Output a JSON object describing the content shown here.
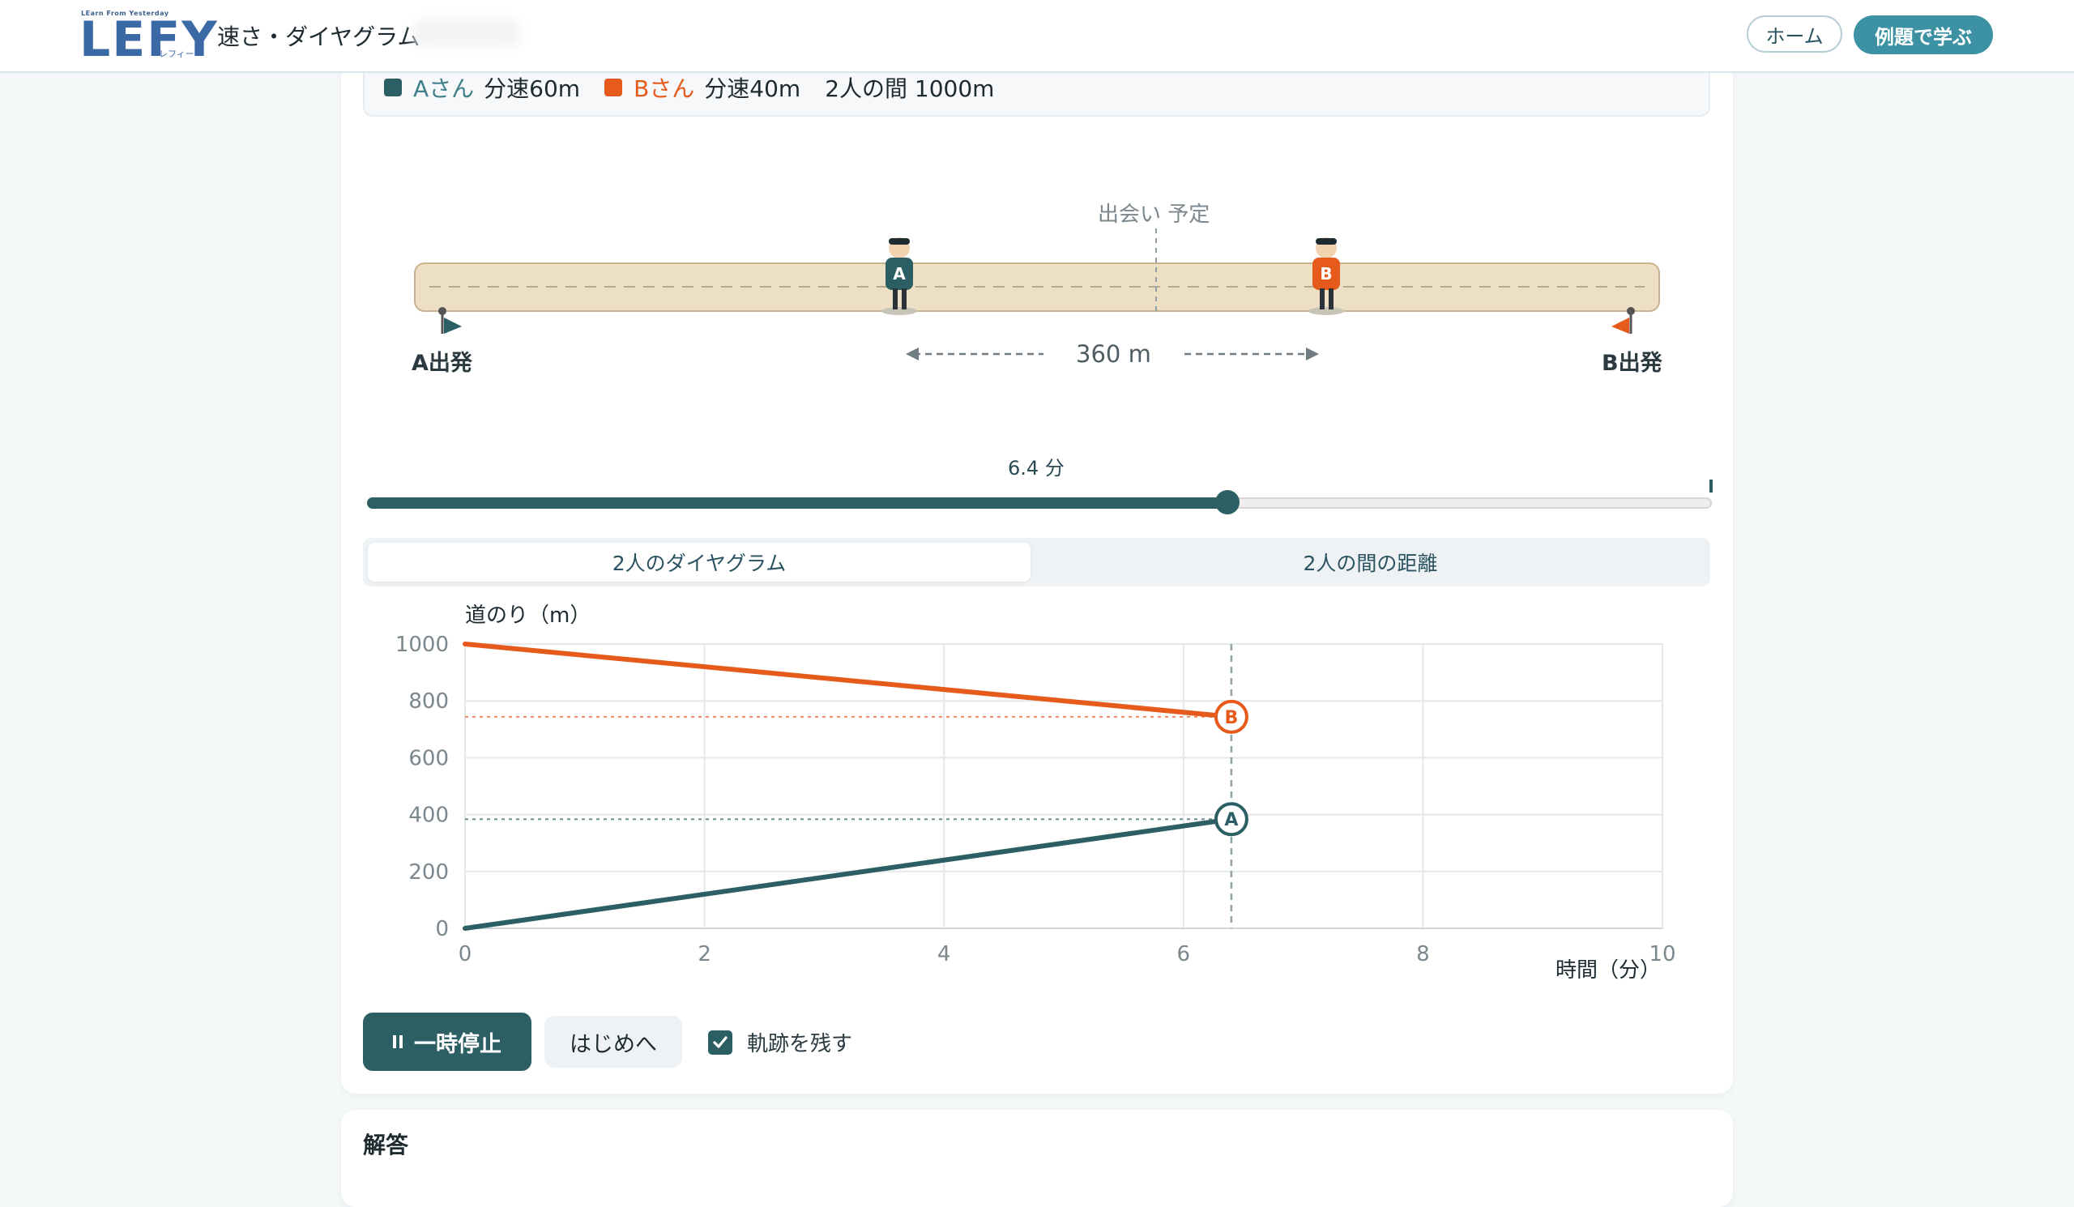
{
  "header": {
    "logo_tagline": "LEarn From Yesterday",
    "logo_word": "LEFY",
    "logo_kana": "レフィー",
    "title": "速さ・ダイヤグラム",
    "home_label": "ホーム",
    "learn_label": "例題で学ぶ"
  },
  "info": {
    "a_name": "Aさん",
    "a_speed": "分速60m",
    "b_name": "Bさん",
    "b_speed": "分速40m",
    "gap": "2人の間 1000m"
  },
  "track": {
    "meet_label": "出会い 予定",
    "start_a": "A出発",
    "start_b": "B出発",
    "distance_label": "360 m",
    "runner_a": "A",
    "runner_b": "B"
  },
  "slider": {
    "time_label": "6.4 分",
    "value_minutes": 6.4,
    "max_minutes": 10
  },
  "tabs": [
    {
      "label": "2人のダイヤグラム",
      "active": true
    },
    {
      "label": "2人の間の距離",
      "active": false
    }
  ],
  "chart_data": {
    "type": "line",
    "ylabel": "道のり（m）",
    "xlabel": "時間（分）",
    "xlim": [
      0,
      10
    ],
    "ylim": [
      0,
      1000
    ],
    "xticks": [
      0,
      2,
      4,
      6,
      8,
      10
    ],
    "yticks": [
      0,
      200,
      400,
      600,
      800,
      1000
    ],
    "grid": true,
    "series": [
      {
        "name": "A",
        "color": "#2c5f64",
        "x": [
          0,
          6.4
        ],
        "y": [
          0,
          384
        ]
      },
      {
        "name": "B",
        "color": "#e65a1c",
        "x": [
          0,
          6.4
        ],
        "y": [
          1000,
          744
        ]
      }
    ],
    "current_time": 6.4
  },
  "controls": {
    "pause_label": "一時停止",
    "reset_label": "はじめへ",
    "trail_label": "軌跡を残す",
    "trail_checked": true
  },
  "answer": {
    "title": "解答"
  },
  "colors": {
    "accent": "#2c5f64",
    "a": "#2c5f64",
    "b": "#e65a1c",
    "brand": "#3c92a3"
  }
}
